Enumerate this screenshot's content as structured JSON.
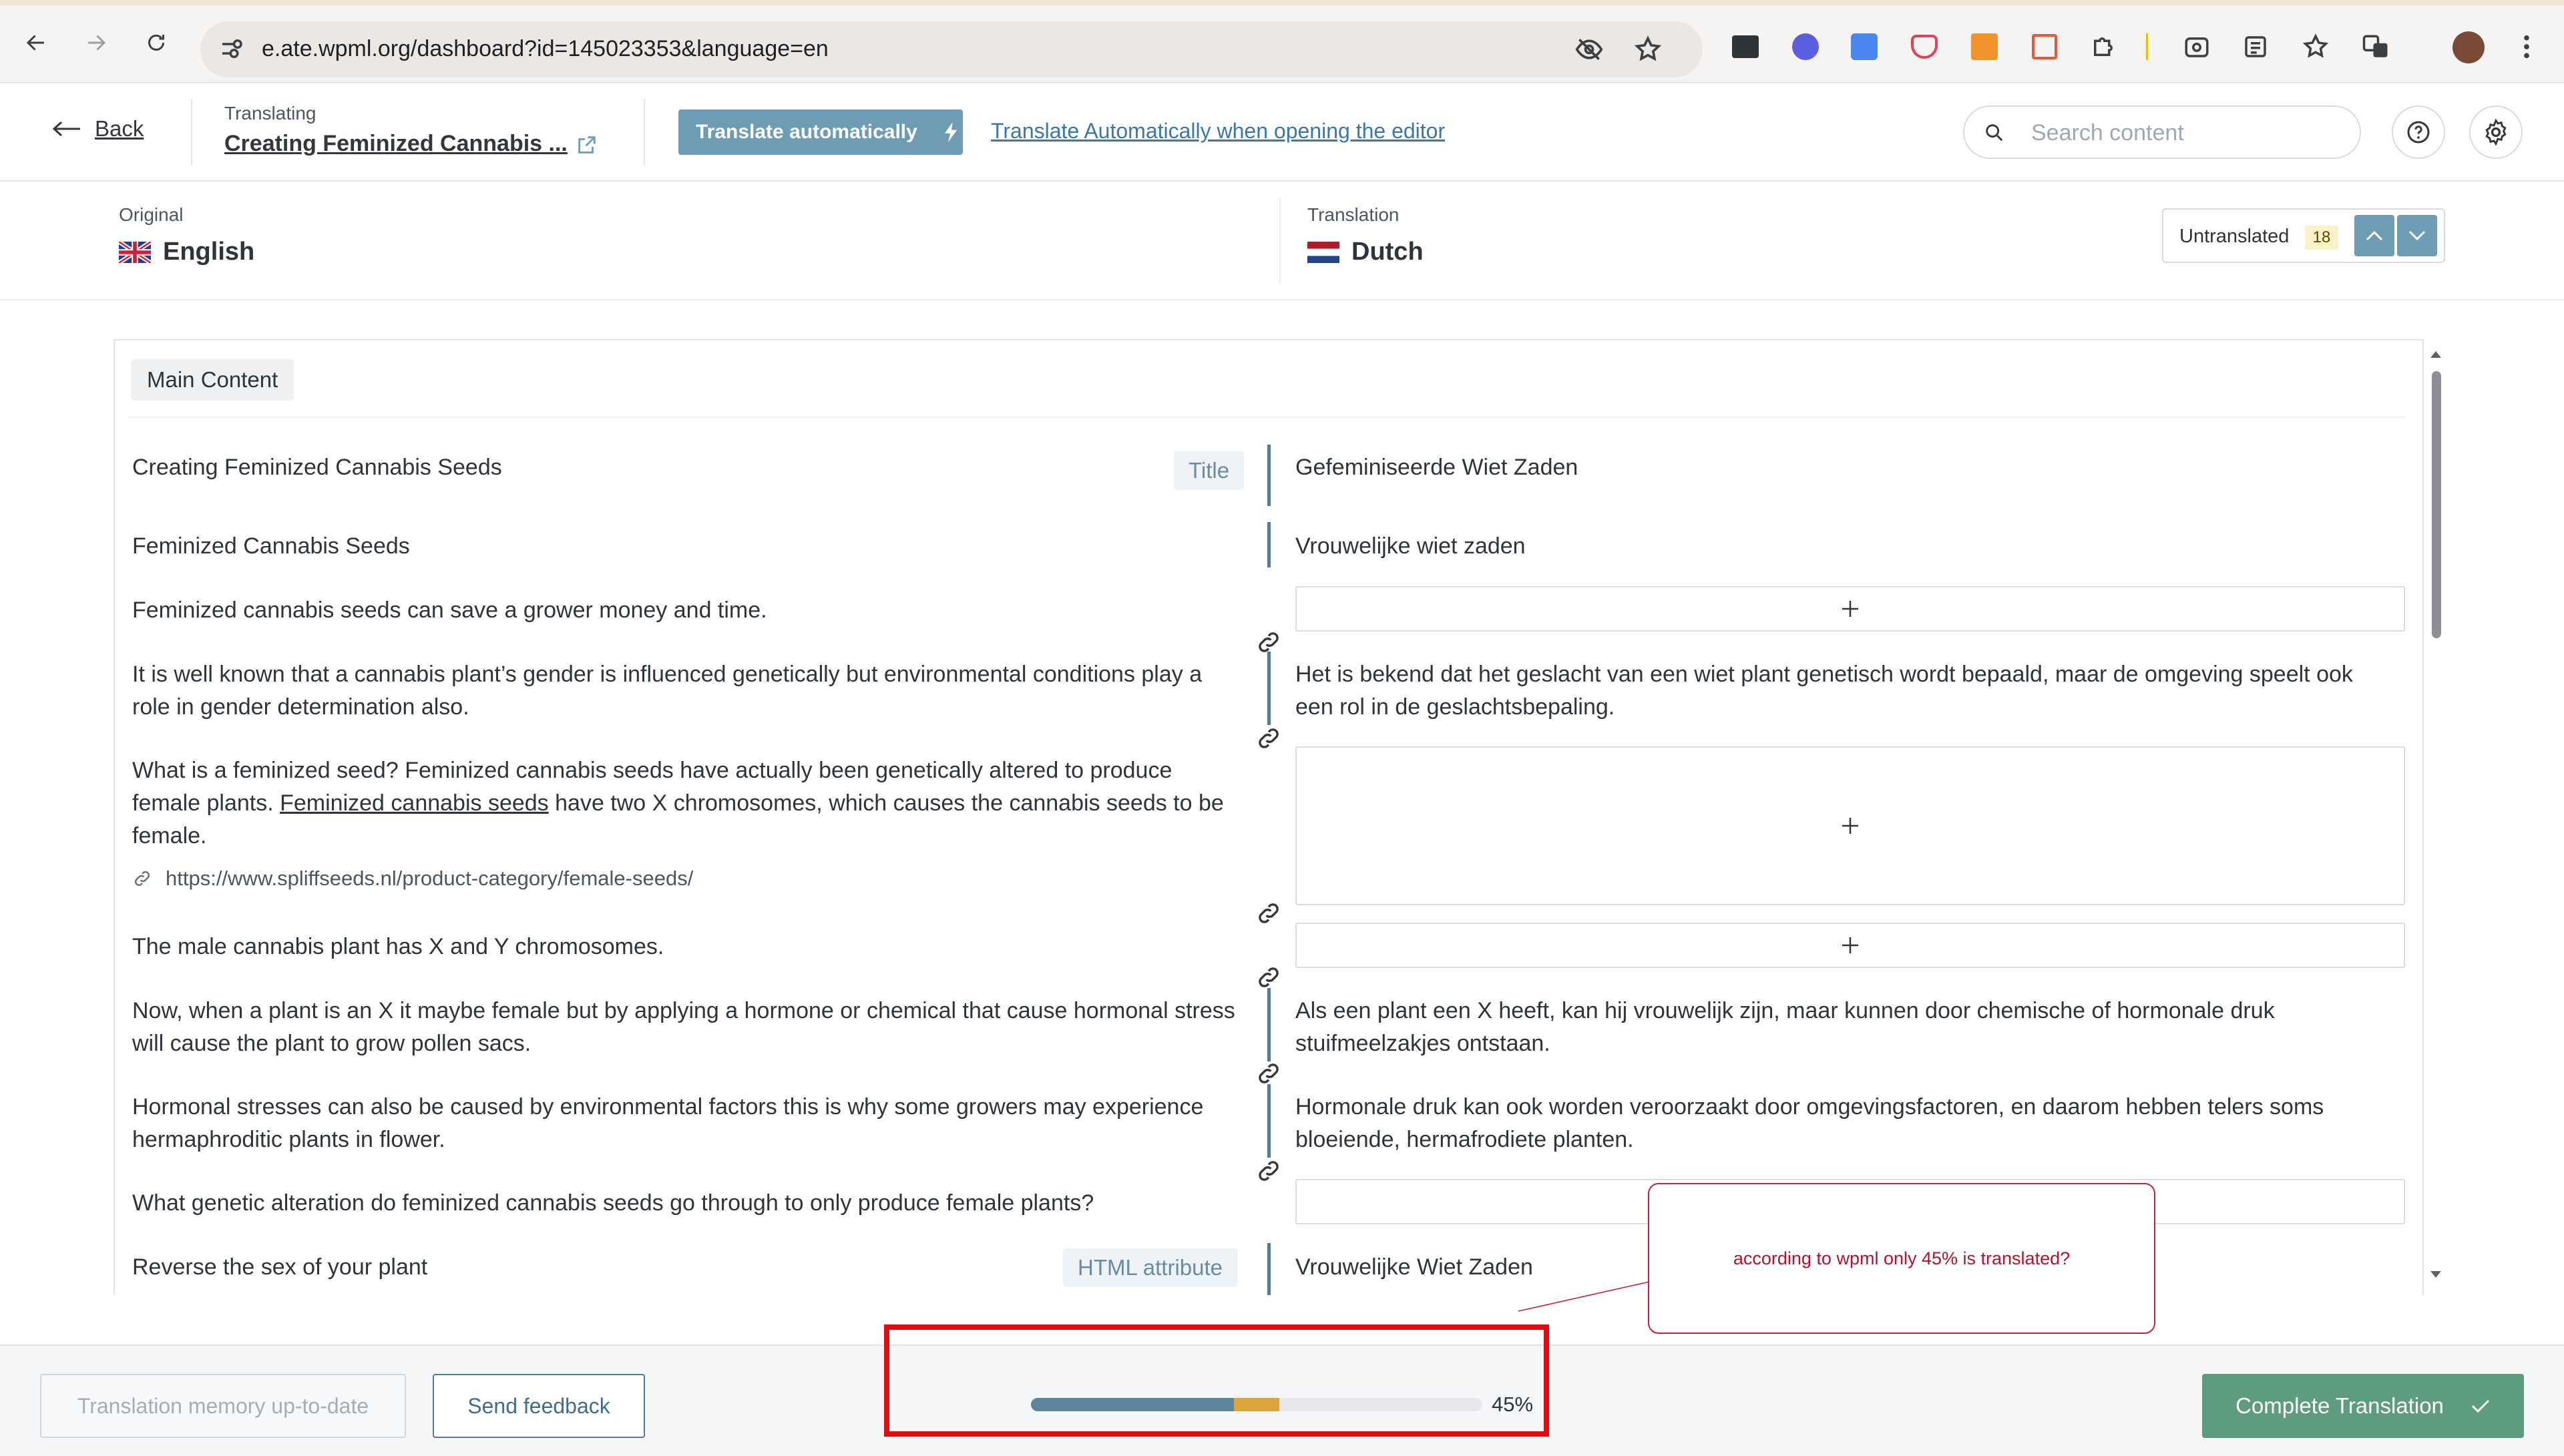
{
  "browser": {
    "url": "e.ate.wpml.org/dashboard?id=145023353&language=en",
    "icons": [
      "back-icon",
      "forward-icon",
      "reload-icon",
      "site-info-icon",
      "eye-off-icon",
      "star-icon",
      "extension-1-icon",
      "extension-2-icon",
      "translate-ext-icon",
      "pocket-icon",
      "js-icon",
      "gift-icon",
      "puzzle-icon",
      "screenshot-icon",
      "reading-list-icon",
      "favorites-icon",
      "translate-icon",
      "profile-avatar",
      "menu-icon"
    ]
  },
  "header": {
    "back_label": "Back",
    "translating_label": "Translating",
    "doc_title": "Creating Feminized Cannabis ...",
    "translate_auto_label": "Translate automatically",
    "translate_auto_link": "Translate Automatically when opening the editor",
    "search_placeholder": "Search content"
  },
  "languages": {
    "original_label": "Original",
    "original_name": "English",
    "translation_label": "Translation",
    "translation_name": "Dutch",
    "untranslated_label": "Untranslated",
    "untranslated_count": "18"
  },
  "editor": {
    "section_label": "Main Content",
    "rows": [
      {
        "source": "Creating Feminized Cannabis Seeds",
        "tag": "Title",
        "target": "Gefeminiseerde Wiet Zaden"
      },
      {
        "source": "Feminized Cannabis Seeds",
        "target": "Vrouwelijke wiet zaden"
      },
      {
        "source": "Feminized cannabis seeds can save a grower money and time.",
        "target": ""
      },
      {
        "source": "It is well known that a cannabis plant’s gender is influenced genetically but environmental conditions play a role in gender determination also.",
        "target": "Het is bekend dat het geslacht van een wiet plant genetisch wordt bepaald, maar de omgeving speelt ook een rol in de geslachtsbepaling."
      },
      {
        "source_a": "What is a feminized seed? Feminized cannabis seeds have actually been genetically altered to produce female plants. ",
        "source_link": "Feminized cannabis seeds",
        "source_b": " have two X chromosomes, which causes the cannabis seeds to be female.",
        "url": "https://www.spliffseeds.nl/product-category/female-seeds/",
        "target": ""
      },
      {
        "source": "The male cannabis plant has X and Y chromosomes.",
        "target": ""
      },
      {
        "source": "Now, when a plant is an X it maybe female but by applying a hormone or chemical that cause hormonal stress will cause the plant to grow pollen sacs.",
        "target": "Als een plant een X heeft, kan hij vrouwelijk zijn, maar kunnen door chemische of hormonale druk stuifmeelzakjes ontstaan."
      },
      {
        "source": "Hormonal stresses can also be caused by environmental factors this is why some growers may experience hermaphroditic plants in flower.",
        "target": "Hormonale druk kan ook worden veroorzaakt door omgevingsfactoren, en daarom hebben telers soms bloeiende, hermafrodiete planten."
      },
      {
        "source": "What genetic alteration do feminized cannabis seeds go through to only produce female plants?",
        "target": ""
      },
      {
        "source": "Reverse the sex of your plant",
        "tag": "HTML attribute",
        "target": "Vrouwelijke Wiet Zaden"
      }
    ]
  },
  "callout": {
    "text": "according to wpml only 45% is translated?"
  },
  "footer": {
    "tm_label": "Translation memory up-to-date",
    "feedback_label": "Send feedback",
    "progress_percent": "45%",
    "progress_value": 0.45,
    "progress_warn_value": 0.1,
    "complete_label": "Complete Translation"
  },
  "colors": {
    "accent": "#6f9cb5",
    "complete": "#5d9c7d",
    "highlight": "#e20d12"
  }
}
